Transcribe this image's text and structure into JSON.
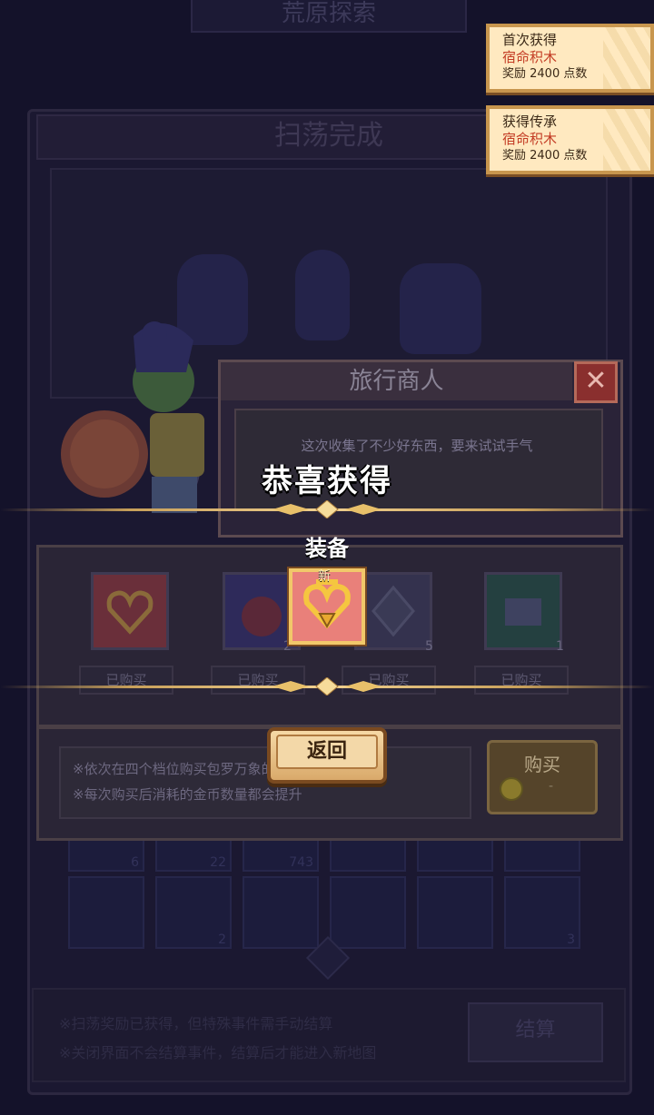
{
  "background": {
    "top_title": "荒原探索",
    "sweep_title": "扫荡完成",
    "inventory_counts": [
      "6",
      "22",
      "743",
      "2",
      "3"
    ],
    "bottom_lines": [
      "※扫荡奖励已获得，但特殊事件需手动结算",
      "※关闭界面不会结算事件，结算后才能进入新地图"
    ],
    "settle_button": "结算"
  },
  "toasts": [
    {
      "title": "首次获得",
      "item": "宿命积木",
      "reward": "奖励 2400 点数"
    },
    {
      "title": "获得传承",
      "item": "宿命积木",
      "reward": "奖励 2400 点数"
    }
  ],
  "merchant": {
    "title": "旅行商人",
    "close_icon": "close-x-icon",
    "dialog": "这次收集了不少好东西，要来试试手气",
    "items": [
      {
        "icon": "heart-amulet-icon",
        "count": "",
        "status": "已购买"
      },
      {
        "icon": "apple-icon",
        "count": "2",
        "status": "已购买"
      },
      {
        "icon": "gem-icon",
        "count": "5",
        "status": "已购买"
      },
      {
        "icon": "chest-icon",
        "count": "1",
        "status": "已购买"
      }
    ],
    "info": [
      "※依次在四个档位购买包罗万象的宝物",
      "※每次购买后消耗的金币数量都会提升"
    ],
    "buy_label": "购买",
    "buy_price": "-"
  },
  "reward": {
    "congrats": "恭喜获得",
    "category": "装备",
    "new_tag": "新",
    "item_icon": "golden-heart-amulet-icon",
    "return_button": "返回"
  },
  "colors": {
    "accent_gold": "#c8a05a",
    "toast_bg": "#ffe9c0",
    "toast_item": "#c33c24",
    "reward_bg": "#e9807a"
  }
}
